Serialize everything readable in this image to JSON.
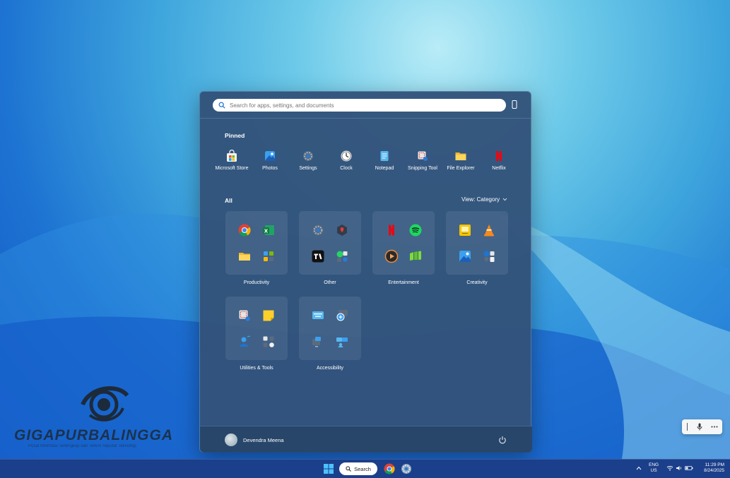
{
  "search": {
    "placeholder": "Search for apps, settings, and documents"
  },
  "pinned": {
    "label": "Pinned",
    "items": [
      {
        "label": "Microsoft Store",
        "icon": "microsoft-store-icon"
      },
      {
        "label": "Photos",
        "icon": "photos-icon"
      },
      {
        "label": "Settings",
        "icon": "settings-icon"
      },
      {
        "label": "Clock",
        "icon": "clock-icon"
      },
      {
        "label": "Notepad",
        "icon": "notepad-icon"
      },
      {
        "label": "Snipping Tool",
        "icon": "snipping-tool-icon"
      },
      {
        "label": "File Explorer",
        "icon": "file-explorer-icon"
      },
      {
        "label": "Netflix",
        "icon": "netflix-icon"
      }
    ]
  },
  "all": {
    "label": "All",
    "view_label": "View: Category",
    "categories": [
      {
        "label": "Productivity",
        "icons": [
          "chrome-icon",
          "excel-icon",
          "file-explorer-icon",
          "control-panel-icon"
        ]
      },
      {
        "label": "Other",
        "icons": [
          "settings-icon",
          "security-icon",
          "tradingview-icon",
          "whatsapp-icon"
        ]
      },
      {
        "label": "Entertainment",
        "icons": [
          "netflix-icon",
          "spotify-icon",
          "media-player-icon",
          "game-icon"
        ]
      },
      {
        "label": "Creativity",
        "icons": [
          "sketch-icon",
          "vlc-icon",
          "photos-icon",
          "paint-icon"
        ]
      },
      {
        "label": "Utilities & Tools",
        "icons": [
          "snipping-tool-icon",
          "sticky-notes-icon",
          "people-icon",
          "tools-icon"
        ]
      },
      {
        "label": "Accessibility",
        "icons": [
          "on-screen-keyboard-icon",
          "magnifier-icon",
          "narrator-icon",
          "remote-desktop-icon"
        ]
      }
    ]
  },
  "user": {
    "name": "Devendra Meena"
  },
  "taskbar": {
    "search_label": "Search",
    "lang_line1": "ENG",
    "lang_line2": "US",
    "time": "11:29 PM",
    "date": "8/24/2025"
  },
  "watermark": {
    "title": "GIGAPURBALINGGA",
    "subtitle": "Pusat Informasi Terlengkap dan Terkini Seputar Teknologi"
  },
  "colors": {
    "accent": "#1e74d2",
    "menu_bg": "#32527a"
  }
}
